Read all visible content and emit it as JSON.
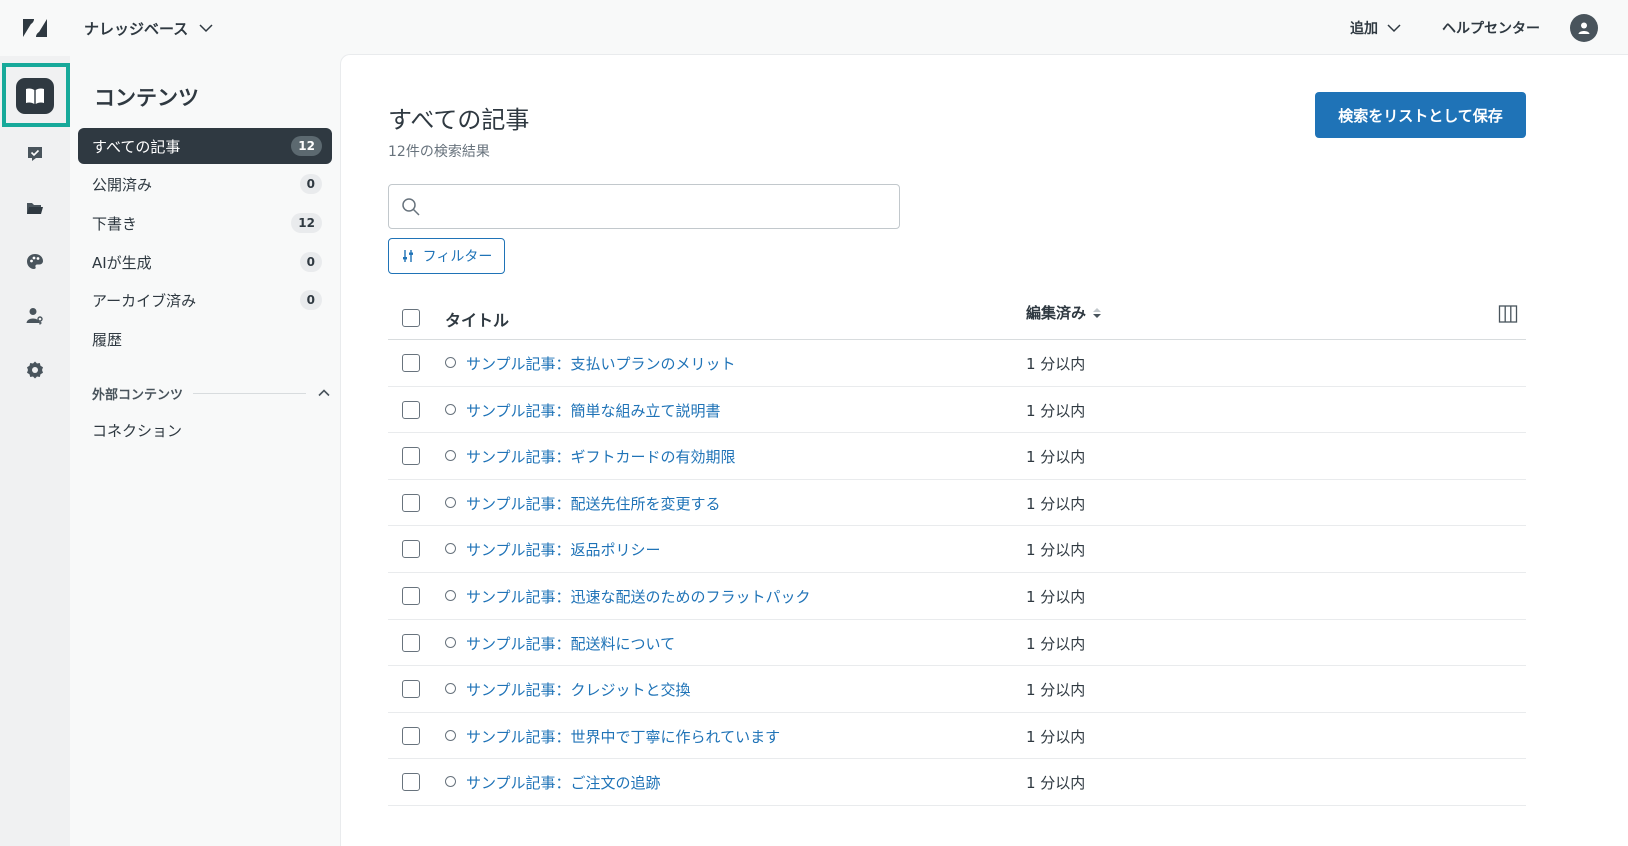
{
  "topbar": {
    "product": "ナレッジベース",
    "add_label": "追加",
    "help_center": "ヘルプセンター"
  },
  "rail": {
    "icons": [
      "knowledge-icon",
      "review-icon",
      "folder-icon",
      "palette-icon",
      "user-permissions-icon",
      "settings-icon"
    ]
  },
  "subnav": {
    "title": "コンテンツ",
    "items": [
      {
        "label": "すべての記事",
        "count": "12"
      },
      {
        "label": "公開済み",
        "count": "0"
      },
      {
        "label": "下書き",
        "count": "12"
      },
      {
        "label": "AIが生成",
        "count": "0"
      },
      {
        "label": "アーカイブ済み",
        "count": "0"
      },
      {
        "label": "履歴"
      }
    ],
    "external_section": "外部コンテンツ",
    "connections": "コネクション"
  },
  "main": {
    "title": "すべての記事",
    "result_count": "12件の検索結果",
    "save_button": "検索をリストとして保存",
    "search_placeholder": "",
    "filter_button": "フィルター",
    "columns": {
      "title": "タイトル",
      "edited": "編集済み"
    },
    "rows": [
      {
        "title": "サンプル記事：支払いプランのメリット",
        "edited": "1 分以内"
      },
      {
        "title": "サンプル記事：簡単な組み立て説明書",
        "edited": "1 分以内"
      },
      {
        "title": "サンプル記事：ギフトカードの有効期限",
        "edited": "1 分以内"
      },
      {
        "title": "サンプル記事：配送先住所を変更する",
        "edited": "1 分以内"
      },
      {
        "title": "サンプル記事：返品ポリシー",
        "edited": "1 分以内"
      },
      {
        "title": "サンプル記事：迅速な配送のためのフラットパック",
        "edited": "1 分以内"
      },
      {
        "title": "サンプル記事：配送料について",
        "edited": "1 分以内"
      },
      {
        "title": "サンプル記事：クレジットと交換",
        "edited": "1 分以内"
      },
      {
        "title": "サンプル記事：世界中で丁寧に作られています",
        "edited": "1 分以内"
      },
      {
        "title": "サンプル記事：ご注文の追跡",
        "edited": "1 分以内"
      }
    ]
  },
  "colors": {
    "accent": "#1f73b7",
    "highlight": "#17a99a",
    "nav_active": "#2f3941"
  }
}
